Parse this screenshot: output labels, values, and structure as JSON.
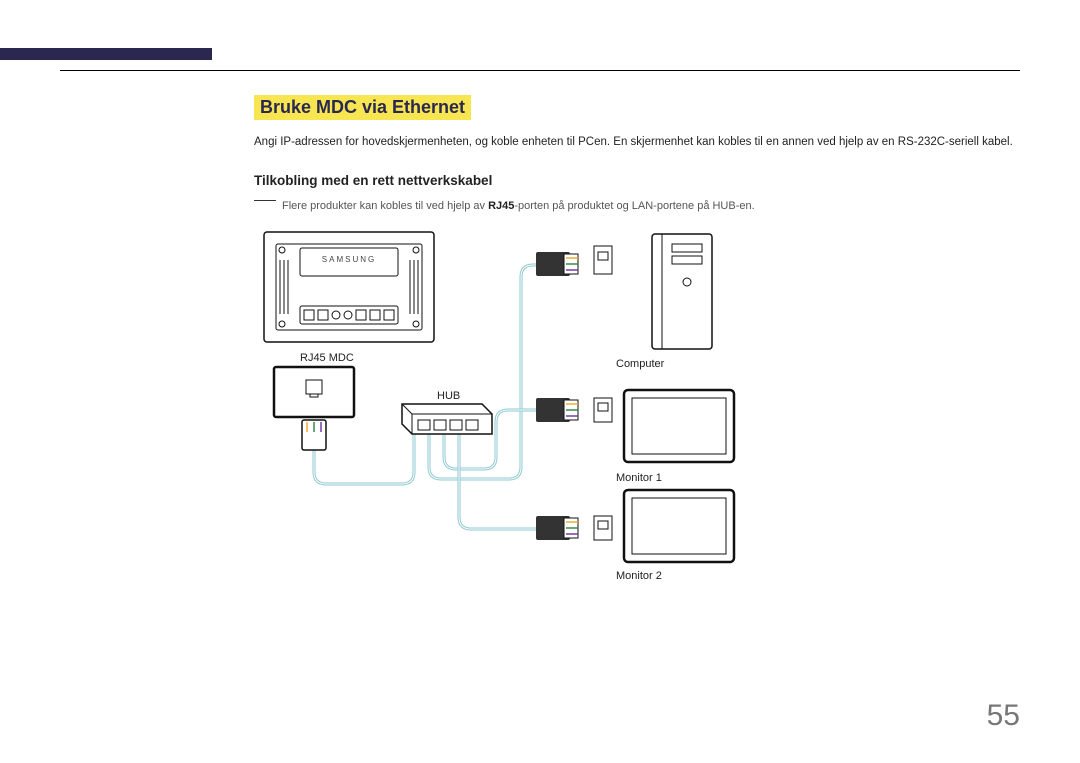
{
  "headings": {
    "section": "Bruke MDC via Ethernet",
    "subsection": "Tilkobling med en rett nettverkskabel"
  },
  "paragraph": "Angi IP-adressen for hovedskjermenheten, og koble enheten til PCen. En skjermenhet kan kobles til en annen ved hjelp av en RS-232C-seriell kabel.",
  "note": {
    "prefix": "Flere produkter kan kobles til ved hjelp av ",
    "bold": "RJ45",
    "suffix": "-porten på produktet og LAN-portene på HUB-en."
  },
  "labels": {
    "rj45": "RJ45 MDC",
    "hub": "HUB",
    "computer": "Computer",
    "monitor1": "Monitor 1",
    "monitor2": "Monitor 2"
  },
  "page_number": "55"
}
